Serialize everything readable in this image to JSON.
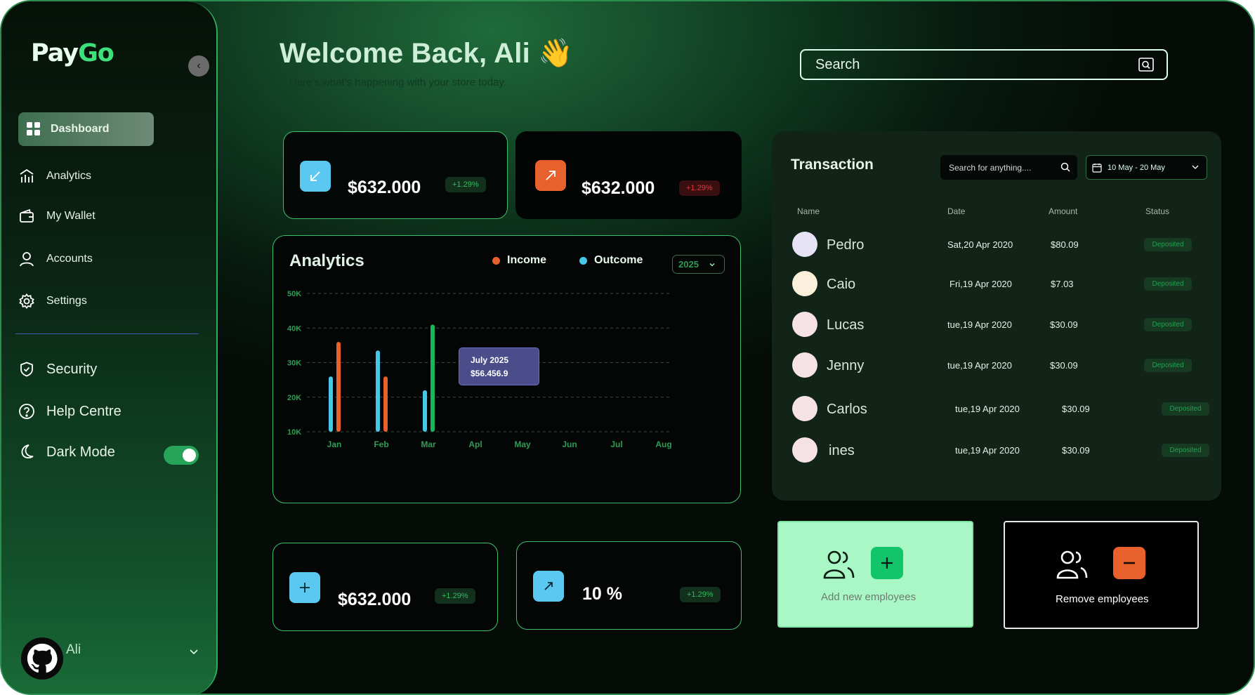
{
  "app": {
    "logo_pay": "Pay",
    "logo_go": "Go"
  },
  "sidebar": {
    "items": [
      {
        "label": "Dashboard",
        "icon": "grid-icon"
      },
      {
        "label": "Analytics",
        "icon": "analytics-icon"
      },
      {
        "label": "My Wallet",
        "icon": "wallet-icon"
      },
      {
        "label": "Accounts",
        "icon": "user-icon"
      },
      {
        "label": "Settings",
        "icon": "gear-icon"
      }
    ],
    "secondary": [
      {
        "label": "Security",
        "icon": "shield-icon"
      },
      {
        "label": "Help Centre",
        "icon": "help-icon"
      },
      {
        "label": "Dark Mode",
        "icon": "moon-icon",
        "toggle": true
      }
    ],
    "user": {
      "name": "Ali"
    }
  },
  "header": {
    "title": "Welcome Back, Ali 👋",
    "subtitle": "Here's what's happening with your store today.",
    "search_placeholder": "Search"
  },
  "stats": {
    "top": [
      {
        "amount": "$632.000",
        "change": "+1.29%",
        "trend": "up",
        "icon": "arrow-down-left-icon",
        "color": "#5bc8f2"
      },
      {
        "amount": "$632.000",
        "change": "+1.29%",
        "trend": "down",
        "icon": "arrow-up-right-icon",
        "color": "#e8602c"
      }
    ],
    "bottom": [
      {
        "amount": "$632.000",
        "change": "+1.29%",
        "icon": "plus-icon",
        "color": "#5bc8f2"
      },
      {
        "amount": "10 %",
        "change": "+1.29%",
        "icon": "arrow-up-right-icon",
        "color": "#5bc8f2"
      }
    ]
  },
  "analytics": {
    "title": "Analytics",
    "legend": [
      {
        "label": "Income",
        "color": "#e8602c"
      },
      {
        "label": "Outcome",
        "color": "#45c8e8"
      }
    ],
    "year": "2025",
    "tooltip": {
      "label": "July 2025",
      "value": "$56.456.9"
    }
  },
  "chart_data": {
    "type": "bar",
    "categories": [
      "Jan",
      "Feb",
      "Mar",
      "Apl",
      "May",
      "Jun",
      "Jul",
      "Aug"
    ],
    "y_ticks": [
      "50K",
      "40K",
      "30K",
      "20K",
      "10K"
    ],
    "ylim": [
      10,
      50
    ],
    "grid": true,
    "series": [
      {
        "name": "Outcome",
        "color": "#45c8e8",
        "values": [
          26,
          33.5,
          22,
          null,
          null,
          null,
          null,
          null
        ]
      },
      {
        "name": "Income",
        "color": "#e8602c",
        "values": [
          36,
          26,
          41,
          null,
          null,
          null,
          null,
          null
        ]
      }
    ]
  },
  "transactions": {
    "title": "Transaction",
    "search_placeholder": "Search for anything....",
    "date_range": "10 May - 20 May",
    "columns": [
      "Name",
      "Date",
      "Amount",
      "Status"
    ],
    "rows": [
      {
        "name": "Pedro",
        "date": "Sat,20 Apr 2020",
        "amount": "$80.09",
        "status": "Deposited",
        "avatar": "#e6e3f6"
      },
      {
        "name": "Caio",
        "date": "Fri,19 Apr 2020",
        "amount": "$7.03",
        "status": "Deposited",
        "avatar": "#fbf0dc"
      },
      {
        "name": "Lucas",
        "date": "tue,19 Apr 2020",
        "amount": "$30.09",
        "status": "Deposited",
        "avatar": "#f6e1e4"
      },
      {
        "name": "Jenny",
        "date": "tue,19 Apr 2020",
        "amount": "$30.09",
        "status": "Deposited",
        "avatar": "#f6e1e4"
      },
      {
        "name": "Carlos",
        "date": "tue,19 Apr 2020",
        "amount": "$30.09",
        "status": "Deposited",
        "avatar": "#f6e1e4"
      },
      {
        "name": "ines",
        "date": "tue,19 Apr 2020",
        "amount": "$30.09",
        "status": "Deposited",
        "avatar": "#f6e1e4"
      }
    ]
  },
  "employees": {
    "add_label": "Add new employees",
    "remove_label": "Remove employees"
  }
}
